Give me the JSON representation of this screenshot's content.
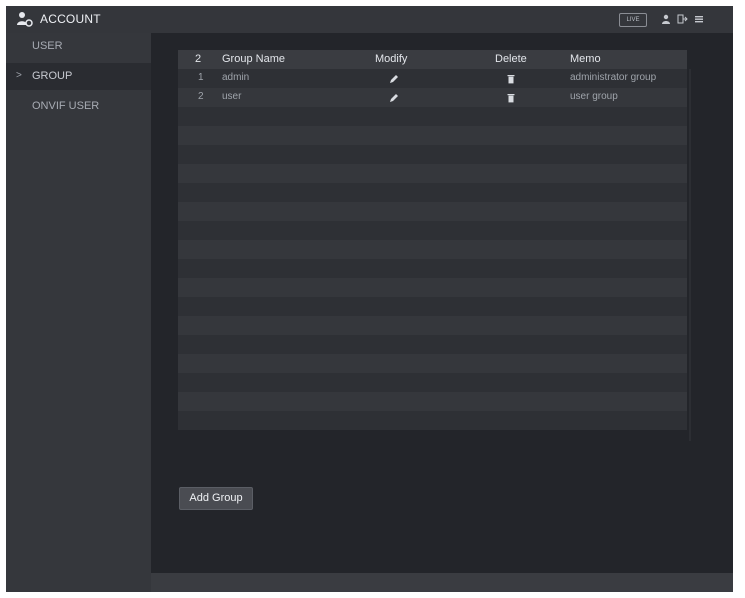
{
  "header": {
    "title": "ACCOUNT",
    "live_label": "LIVE",
    "icons": [
      "account-icon",
      "user-icon",
      "logout-icon",
      "menu-icon"
    ]
  },
  "sidebar": {
    "items": [
      {
        "label": "USER",
        "active": false
      },
      {
        "label": "GROUP",
        "active": true
      },
      {
        "label": "ONVIF USER",
        "active": false
      }
    ],
    "active_marker": ">"
  },
  "table": {
    "columns": [
      "2",
      "Group Name",
      "Modify",
      "Delete",
      "Memo"
    ],
    "rows": [
      {
        "index": "1",
        "group_name": "admin",
        "memo": "administrator group"
      },
      {
        "index": "2",
        "group_name": "user",
        "memo": "user group"
      }
    ],
    "modify_icon": "pencil-icon",
    "delete_icon": "trash-icon"
  },
  "actions": {
    "add_group_label": "Add Group"
  },
  "colors": {
    "background": "#23252a",
    "sidebar": "#35373c",
    "header": "#34363b",
    "text": "#e3e6eb",
    "muted_text": "#9fa4ab"
  }
}
